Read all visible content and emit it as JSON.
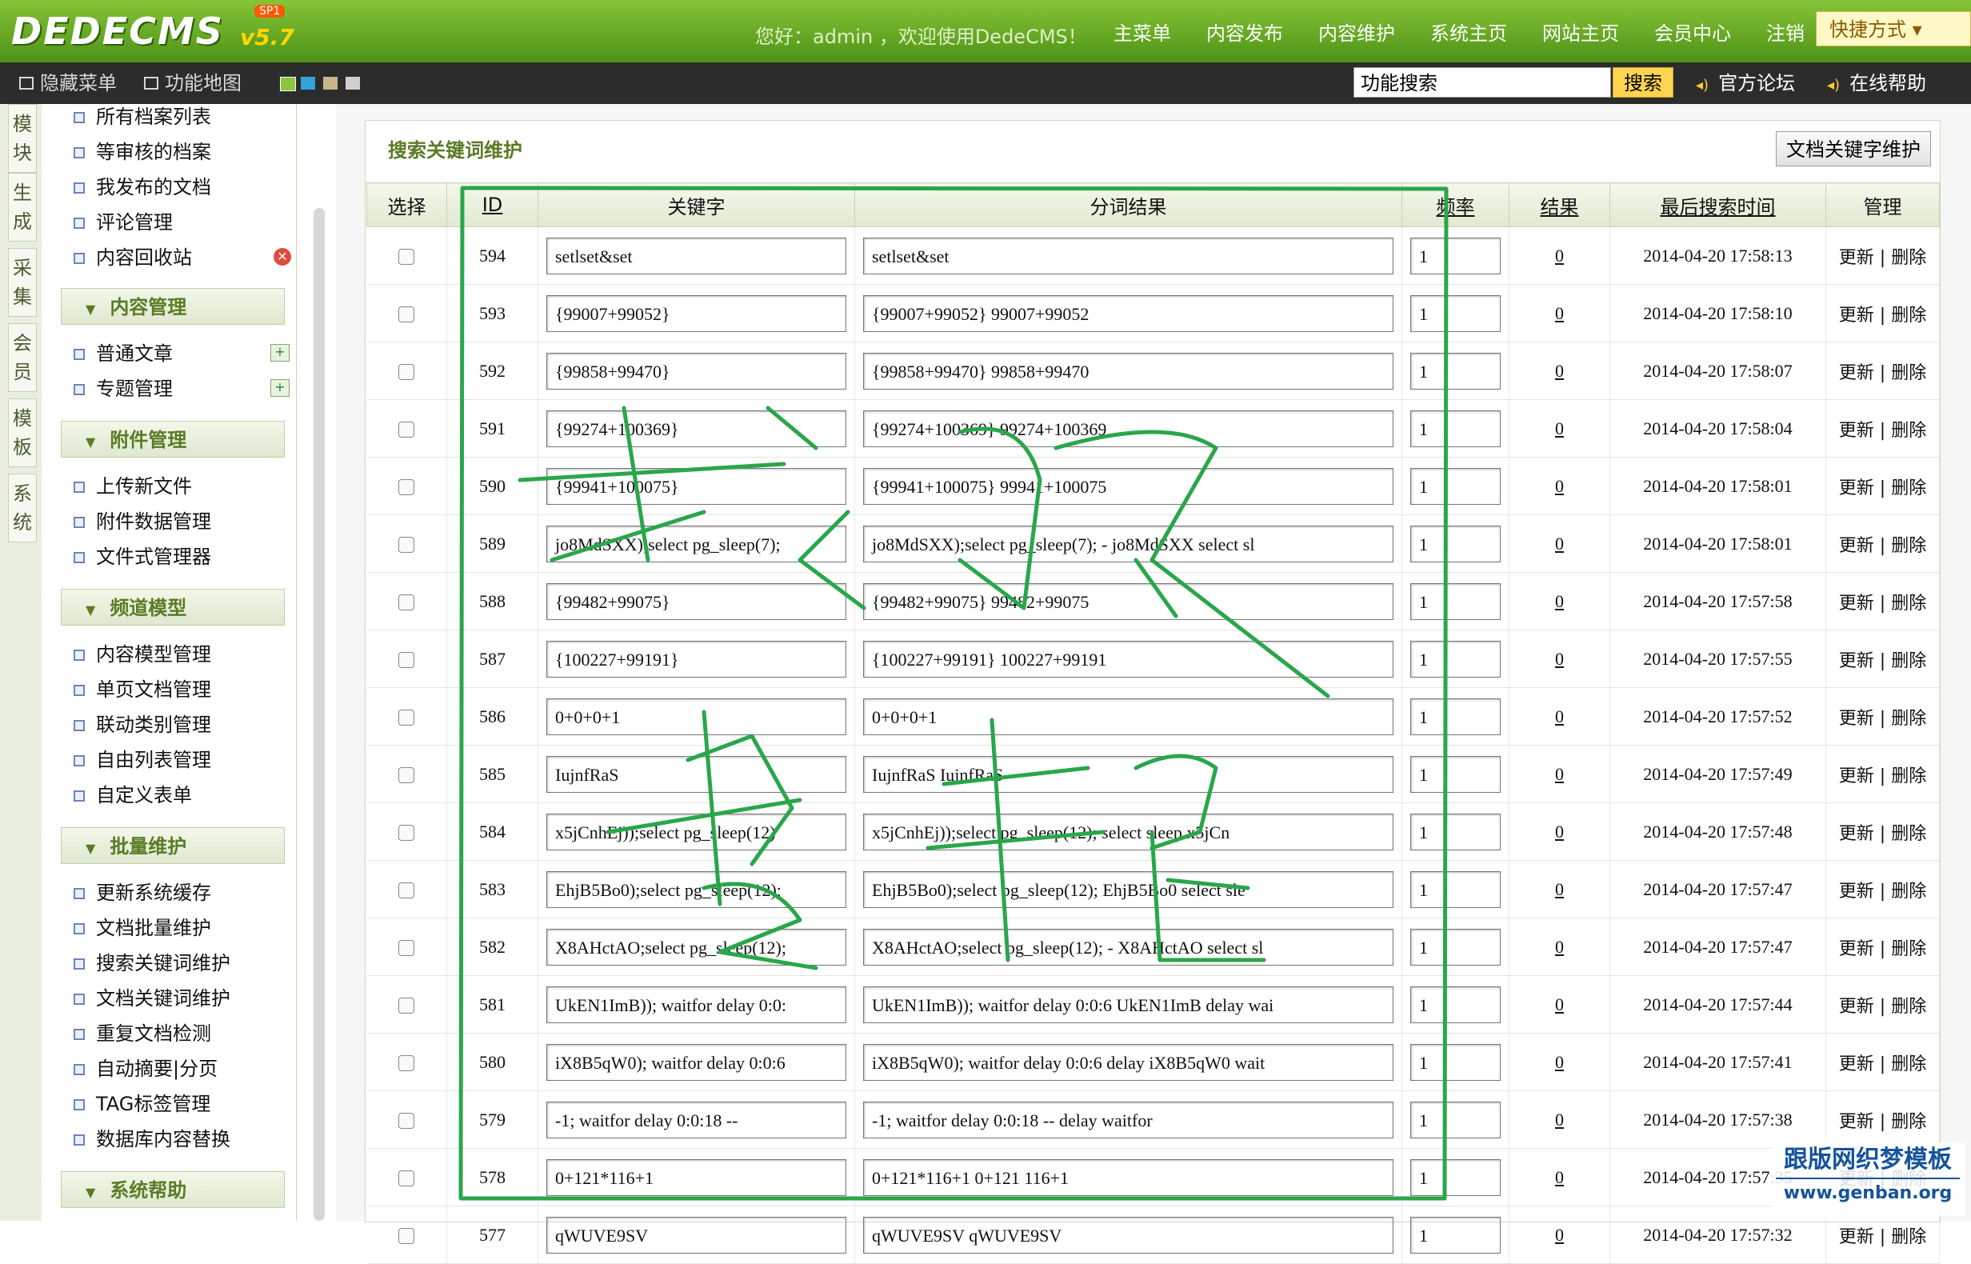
{
  "brand": {
    "logo": "DEDECMS",
    "version": "v5.7",
    "badge": "SP1"
  },
  "header": {
    "welcome": "您好：admin ，欢迎使用DedeCMS！",
    "nav": [
      "主菜单",
      "内容发布",
      "内容维护",
      "系统主页",
      "网站主页",
      "会员中心",
      "注销"
    ],
    "shortcut": "快捷方式 ▾"
  },
  "subbar": {
    "hide_menu": "隐藏菜单",
    "func_map": "功能地图",
    "search_value": "功能搜索",
    "search_button": "搜索",
    "forum": "官方论坛",
    "help": "在线帮助",
    "swatch_colors": [
      "#8cc63f",
      "#33a3dc",
      "#c8b58a",
      "#cfcfcf"
    ]
  },
  "vtabs": [
    "模块",
    "生成",
    "采集",
    "会员",
    "模板",
    "系统"
  ],
  "menu": {
    "g0": [
      "所有档案列表",
      "等审核的档案",
      "我发布的文档",
      "评论管理",
      "内容回收站"
    ],
    "h1": "内容管理",
    "g1": [
      "普通文章",
      "专题管理"
    ],
    "h2": "附件管理",
    "g2": [
      "上传新文件",
      "附件数据管理",
      "文件式管理器"
    ],
    "h3": "频道模型",
    "g3": [
      "内容模型管理",
      "单页文档管理",
      "联动类别管理",
      "自由列表管理",
      "自定义表单"
    ],
    "h4": "批量维护",
    "g4": [
      "更新系统缓存",
      "文档批量维护",
      "搜索关键词维护",
      "文档关键词维护",
      "重复文档检测",
      "自动摘要|分页",
      "TAG标签管理",
      "数据库内容替换"
    ],
    "h5": "系统帮助"
  },
  "panel": {
    "title": "搜索关键词维护",
    "button": "文档关键字维护"
  },
  "table": {
    "headers": [
      "选择",
      "ID",
      "关键字",
      "分词结果",
      "频率",
      "结果",
      "最后搜索时间",
      "管理"
    ],
    "ops": "更新 | 删除",
    "rows": [
      {
        "id": "594",
        "kw": "setlset&set",
        "seg": "setlset&set",
        "freq": "1",
        "res": "0",
        "time": "2014-04-20 17:58:13"
      },
      {
        "id": "593",
        "kw": "{99007+99052}",
        "seg": "{99007+99052} 99007+99052",
        "freq": "1",
        "res": "0",
        "time": "2014-04-20 17:58:10"
      },
      {
        "id": "592",
        "kw": "{99858+99470}",
        "seg": "{99858+99470} 99858+99470",
        "freq": "1",
        "res": "0",
        "time": "2014-04-20 17:58:07"
      },
      {
        "id": "591",
        "kw": "{99274+100369}",
        "seg": "{99274+100369} 99274+100369",
        "freq": "1",
        "res": "0",
        "time": "2014-04-20 17:58:04"
      },
      {
        "id": "590",
        "kw": "{99941+100075}",
        "seg": "{99941+100075} 99941+100075",
        "freq": "1",
        "res": "0",
        "time": "2014-04-20 17:58:01"
      },
      {
        "id": "589",
        "kw": "jo8MdSXX);select pg_sleep(7);",
        "seg": "jo8MdSXX);select pg_sleep(7); - jo8MdSXX select sl",
        "freq": "1",
        "res": "0",
        "time": "2014-04-20 17:58:01"
      },
      {
        "id": "588",
        "kw": "{99482+99075}",
        "seg": "{99482+99075} 99482+99075",
        "freq": "1",
        "res": "0",
        "time": "2014-04-20 17:57:58"
      },
      {
        "id": "587",
        "kw": "{100227+99191}",
        "seg": "{100227+99191} 100227+99191",
        "freq": "1",
        "res": "0",
        "time": "2014-04-20 17:57:55"
      },
      {
        "id": "586",
        "kw": "0+0+0+1",
        "seg": "0+0+0+1",
        "freq": "1",
        "res": "0",
        "time": "2014-04-20 17:57:52"
      },
      {
        "id": "585",
        "kw": "IujnfRaS",
        "seg": "IujnfRaS IujnfRaS",
        "freq": "1",
        "res": "0",
        "time": "2014-04-20 17:57:49"
      },
      {
        "id": "584",
        "kw": "x5jCnhEj));select pg_sleep(12)",
        "seg": "x5jCnhEj));select pg_sleep(12); select sleep x5jCn",
        "freq": "1",
        "res": "0",
        "time": "2014-04-20 17:57:48"
      },
      {
        "id": "583",
        "kw": "EhjB5Bo0);select pg_sleep(12);",
        "seg": "EhjB5Bo0);select pg_sleep(12); EhjB5Bo0 select sle",
        "freq": "1",
        "res": "0",
        "time": "2014-04-20 17:57:47"
      },
      {
        "id": "582",
        "kw": "X8AHctAO;select pg_sleep(12);",
        "seg": "X8AHctAO;select pg_sleep(12); - X8AHctAO select sl",
        "freq": "1",
        "res": "0",
        "time": "2014-04-20 17:57:47"
      },
      {
        "id": "581",
        "kw": "UkEN1ImB)); waitfor delay 0:0:",
        "seg": "UkEN1ImB)); waitfor delay 0:0:6 UkEN1ImB delay wai",
        "freq": "1",
        "res": "0",
        "time": "2014-04-20 17:57:44"
      },
      {
        "id": "580",
        "kw": "iX8B5qW0); waitfor delay 0:0:6",
        "seg": "iX8B5qW0); waitfor delay 0:0:6 delay iX8B5qW0 wait",
        "freq": "1",
        "res": "0",
        "time": "2014-04-20 17:57:41"
      },
      {
        "id": "579",
        "kw": "-1; waitfor delay 0:0:18 --",
        "seg": "-1; waitfor delay 0:0:18 -- delay waitfor",
        "freq": "1",
        "res": "0",
        "time": "2014-04-20 17:57:38"
      },
      {
        "id": "578",
        "kw": "0+121*116+1",
        "seg": "0+121*116+1 0+121 116+1",
        "freq": "1",
        "res": "0",
        "time": "2014-04-20 17:57:35"
      },
      {
        "id": "577",
        "kw": "qWUVE9SV",
        "seg": "qWUVE9SV qWUVE9SV",
        "freq": "1",
        "res": "0",
        "time": "2014-04-20 17:57:32"
      }
    ]
  },
  "watermark": {
    "line1": "跟版网织梦模板",
    "line2": "www.genban.org"
  },
  "annotation_color": "#2aa64a"
}
